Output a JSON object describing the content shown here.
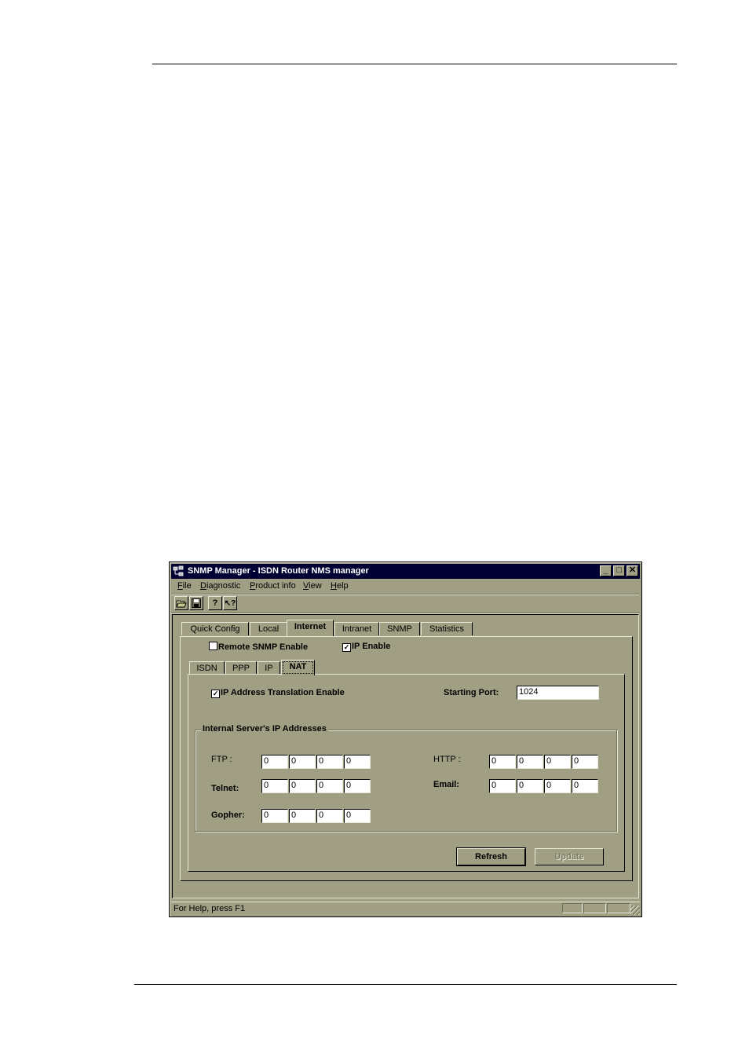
{
  "window": {
    "title": "SNMP Manager - ISDN Router NMS manager",
    "controls": {
      "minimize": "_",
      "maximize": "□",
      "close": "✕"
    }
  },
  "menu": [
    {
      "label": "File",
      "mnemonic": "F",
      "rest": "ile"
    },
    {
      "label": "Diagnostic",
      "mnemonic": "D",
      "rest": "iagnostic"
    },
    {
      "label": "Product info",
      "mnemonic": "P",
      "rest": "roduct info"
    },
    {
      "label": "View",
      "mnemonic": "V",
      "rest": "iew"
    },
    {
      "label": "Help",
      "mnemonic": "H",
      "rest": "elp"
    }
  ],
  "toolbar": {
    "open_icon": "📂",
    "save_icon": "💾",
    "about_icon": "?",
    "context_help_icon": "↖?"
  },
  "main_tabs": [
    {
      "label": "Quick Config",
      "active": false
    },
    {
      "label": "Local",
      "active": false
    },
    {
      "label": "Internet",
      "active": true
    },
    {
      "label": "Intranet",
      "active": false
    },
    {
      "label": "SNMP",
      "active": false
    },
    {
      "label": "Statistics",
      "active": false
    }
  ],
  "options": {
    "remote_snmp": {
      "label": "Remote SNMP Enable",
      "checked": false
    },
    "ip_enable": {
      "label": "IP Enable",
      "checked": true
    }
  },
  "sub_tabs": [
    {
      "label": "ISDN",
      "active": false
    },
    {
      "label": "PPP",
      "active": false
    },
    {
      "label": "IP",
      "active": false
    },
    {
      "label": "NAT",
      "active": true
    }
  ],
  "nat": {
    "translation": {
      "label": "IP Address Translation Enable",
      "checked": true
    },
    "starting_port": {
      "label": "Starting Port:",
      "value": "1024"
    },
    "group_title": "Internal Server's IP Addresses",
    "servers": {
      "ftp": {
        "label": "FTP :",
        "octets": [
          "0",
          "0",
          "0",
          "0"
        ]
      },
      "telnet": {
        "label": "Telnet:",
        "octets": [
          "0",
          "0",
          "0",
          "0"
        ]
      },
      "gopher": {
        "label": "Gopher:",
        "octets": [
          "0",
          "0",
          "0",
          "0"
        ]
      },
      "http": {
        "label": "HTTP :",
        "octets": [
          "0",
          "0",
          "0",
          "0"
        ]
      },
      "email": {
        "label": "Email:",
        "octets": [
          "0",
          "0",
          "0",
          "0"
        ]
      }
    },
    "buttons": {
      "refresh": "Refresh",
      "update": "Update"
    }
  },
  "status": {
    "message": "For Help, press F1"
  }
}
